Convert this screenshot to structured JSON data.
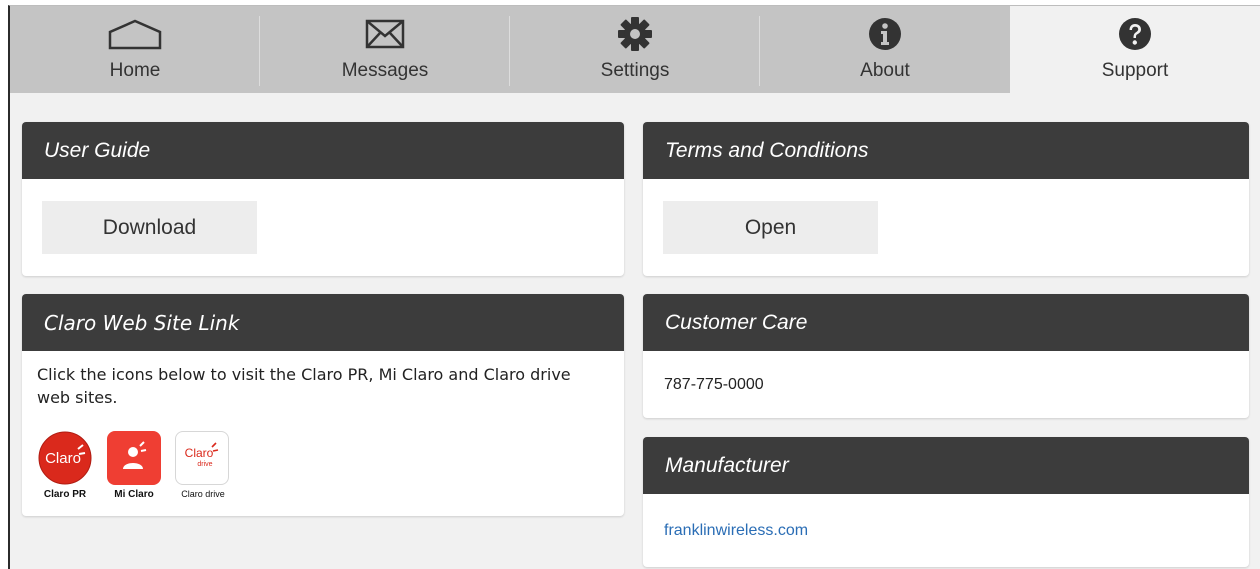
{
  "nav": {
    "tabs": [
      {
        "label": "Home",
        "icon": "home-icon"
      },
      {
        "label": "Messages",
        "icon": "envelope-icon"
      },
      {
        "label": "Settings",
        "icon": "gear-icon"
      },
      {
        "label": "About",
        "icon": "info-icon"
      },
      {
        "label": "Support",
        "icon": "question-icon",
        "active": true
      }
    ]
  },
  "user_guide": {
    "title": "User Guide",
    "button": "Download"
  },
  "terms": {
    "title": "Terms and Conditions",
    "button": "Open"
  },
  "claro_links": {
    "title": "Claro Web Site Link",
    "description": "Click the icons below to visit the Claro PR, Mi Claro and Claro drive web sites.",
    "apps": [
      {
        "label": "Claro PR",
        "logo_text": "Claro",
        "color": "#da291c"
      },
      {
        "label": "Mi Claro",
        "logo_text": "",
        "color": "#ef3e33"
      },
      {
        "label": "Claro drive",
        "logo_text": "Claro",
        "sub_text": "drive",
        "color": "#da291c"
      }
    ]
  },
  "customer_care": {
    "title": "Customer Care",
    "phone": "787-775-0000"
  },
  "manufacturer": {
    "title": "Manufacturer",
    "link": "franklinwireless.com"
  },
  "colors": {
    "header_bg": "#3c3c3c",
    "nav_bg": "#c4c4c4",
    "accent_red": "#da291c",
    "link": "#2a6db5"
  }
}
